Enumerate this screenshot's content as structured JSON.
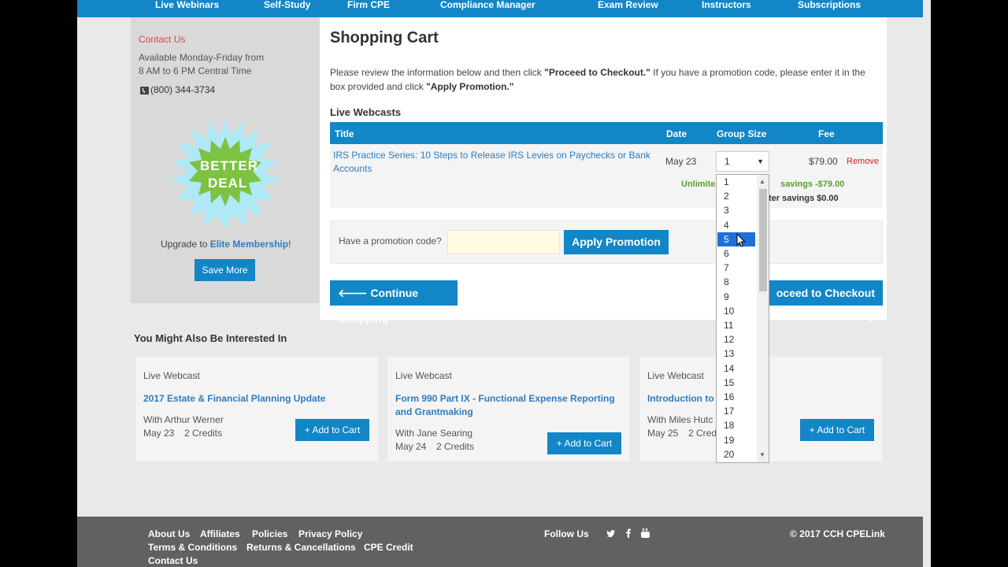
{
  "nav": [
    "Live Webinars",
    "Self-Study",
    "Firm CPE",
    "Compliance Manager",
    "Exam Review",
    "Instructors",
    "Subscriptions"
  ],
  "sidebar": {
    "contact_title": "Contact Us",
    "hours_line1": "Available Monday-Friday from",
    "hours_line2": "8 AM to 6 PM Central Time",
    "phone": "(800) 344-3734",
    "badge_line1": "BETTER",
    "badge_line2": "DEAL",
    "upgrade_prefix": "Upgrade to ",
    "upgrade_link": "Elite Membership",
    "upgrade_suffix": "!",
    "save_more": "Save More"
  },
  "cart": {
    "title": "Shopping Cart",
    "intro_1": "Please review the information below and then click ",
    "intro_b1": "\"Proceed to Checkout.\"",
    "intro_2": " If you have a promotion code, please enter it in the box provided and click ",
    "intro_b2": "\"Apply Promotion.\"",
    "section": "Live Webcasts",
    "headers": {
      "title": "Title",
      "date": "Date",
      "group": "Group Size",
      "fee": "Fee"
    },
    "row": {
      "title": "IRS Practice Series: 10 Steps to Release IRS Levies on Paychecks or Bank Accounts",
      "date": "May 23",
      "group_value": "1",
      "fee": "$79.00",
      "remove": "Remove",
      "savings_label": "Unlimite",
      "savings_value": "savings -$79.00",
      "savings_total": "ter savings $0.00"
    },
    "promo_label": "Have a promotion code?",
    "promo_placeholder": "",
    "apply_promo": "Apply Promotion",
    "continue": "Continue Shopping",
    "checkout": "oceed to Checkout"
  },
  "dropdown": {
    "options": [
      "1",
      "2",
      "3",
      "4",
      "5",
      "6",
      "7",
      "8",
      "9",
      "10",
      "11",
      "12",
      "13",
      "14",
      "15",
      "16",
      "17",
      "18",
      "19",
      "20"
    ],
    "highlighted": "5"
  },
  "interested": {
    "title": "You Might Also Be Interested In",
    "cards": [
      {
        "type": "Live Webcast",
        "title": "2017 Estate & Financial Planning Update",
        "presenter": "With Arthur Werner",
        "date": "May 23",
        "credits": "2 Credits",
        "button": "Add to Cart"
      },
      {
        "type": "Live Webcast",
        "title": "Form 990 Part IX - Functional Expense Reporting and Grantmaking",
        "presenter": "With Jane Searing",
        "date": "May 24",
        "credits": "2 Credits",
        "button": "Add to Cart"
      },
      {
        "type": "Live Webcast",
        "title": "Introduction to",
        "presenter": "With Miles Hutc",
        "date": "May 25",
        "credits": "2 Cred",
        "button": "Add to Cart"
      }
    ]
  },
  "footer": {
    "links": [
      "About Us",
      "Affiliates",
      "Policies",
      "Privacy Policy",
      "Terms & Conditions",
      "Returns & Cancellations",
      "CPE Credit",
      "Contact Us"
    ],
    "follow": "Follow Us",
    "copyright": "© 2017 CCH CPELink"
  },
  "colors": {
    "brand_blue": "#1286c6",
    "contact_red": "#e0434b",
    "savings_green": "#5a9e2f",
    "badge_green": "#7dc242",
    "badge_burst": "#aee9f5"
  },
  "icons": [
    "phone-icon",
    "arrow-left-icon",
    "arrow-right-icon",
    "plus-icon",
    "twitter-icon",
    "facebook-icon",
    "youtube-icon",
    "cursor-icon",
    "chevron-down-icon"
  ]
}
